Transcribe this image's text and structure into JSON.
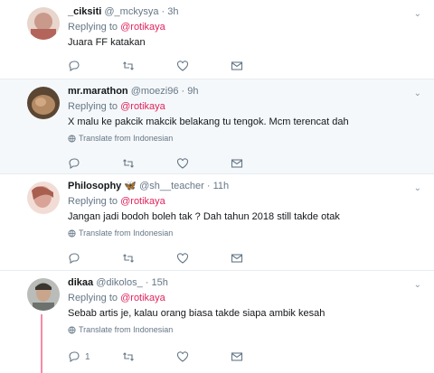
{
  "tweets": [
    {
      "name": "_ciksiti",
      "handle": "@_mckysya",
      "dot": "·",
      "time": "3h",
      "reply_prefix": "Replying to",
      "reply_to": "@rotikaya",
      "text": "Juara FF katakan",
      "translate": "",
      "reply_count": "",
      "avatar_color": "#c99a8c"
    },
    {
      "name": "mr.marathon",
      "handle": "@moezi96",
      "dot": "·",
      "time": "9h",
      "reply_prefix": "Replying to",
      "reply_to": "@rotikaya",
      "text": "X malu ke pakcik makcik belakang tu tengok. Mcm terencat dah",
      "translate": "Translate from Indonesian",
      "reply_count": "",
      "avatar_color": "#8a6d4e"
    },
    {
      "name": "Philosophy",
      "emoji": "🦋",
      "handle": "@sh__teacher",
      "dot": "·",
      "time": "11h",
      "reply_prefix": "Replying to",
      "reply_to": "@rotikaya",
      "text": "Jangan jadi bodoh boleh tak ? Dah tahun 2018 still takde otak",
      "translate": "Translate from Indonesian",
      "reply_count": "",
      "avatar_color": "#d9a497"
    },
    {
      "name": "dikaa",
      "handle": "@dikolos_",
      "dot": "·",
      "time": "15h",
      "reply_prefix": "Replying to",
      "reply_to": "@rotikaya",
      "text": "Sebab artis je, kalau orang biasa takde siapa ambik kesah",
      "translate": "Translate from Indonesian",
      "reply_count": "1",
      "avatar_color": "#8d8f8c"
    }
  ],
  "colors": {
    "mention": "#e0245e",
    "muted": "#657786",
    "thread_line": "#f48ca7",
    "highlight_bg": "#f5f8fa"
  },
  "icons": [
    "reply-icon",
    "retweet-icon",
    "like-icon",
    "dm-icon",
    "globe-icon",
    "chevron-down-icon"
  ]
}
